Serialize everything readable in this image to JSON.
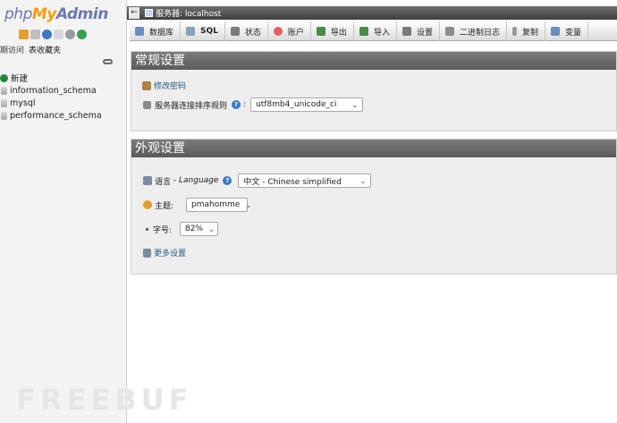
{
  "nav": {
    "logo": {
      "part1": "php",
      "part2": "My",
      "part3": "Admin"
    },
    "tabs": [
      "期访问",
      "表收藏夹"
    ],
    "tree": [
      {
        "label": "新建",
        "icon": "new-icon"
      },
      {
        "label": "information_schema",
        "icon": "database-icon"
      },
      {
        "label": "mysql",
        "icon": "database-icon"
      },
      {
        "label": "performance_schema",
        "icon": "database-icon"
      }
    ]
  },
  "serverbar": {
    "collapse": "←",
    "label": "服务器: localhost"
  },
  "menu": [
    {
      "label": "数据库",
      "icon": "database-icon",
      "color": "#6a8cc0"
    },
    {
      "label": "SQL",
      "icon": "sql-icon",
      "color": "#8aa0c0"
    },
    {
      "label": "状态",
      "icon": "status-icon",
      "color": "#7a7a7a"
    },
    {
      "label": "账户",
      "icon": "users-icon",
      "color": "#e06060"
    },
    {
      "label": "导出",
      "icon": "export-icon",
      "color": "#4a8a4a"
    },
    {
      "label": "导入",
      "icon": "import-icon",
      "color": "#4a8a4a"
    },
    {
      "label": "设置",
      "icon": "wrench-icon",
      "color": "#7a7a7a"
    },
    {
      "label": "二进制日志",
      "icon": "binlog-icon",
      "color": "#8a8a8a"
    },
    {
      "label": "复制",
      "icon": "replication-icon",
      "color": "#9a9a9a"
    },
    {
      "label": "变量",
      "icon": "variables-icon",
      "color": "#6a8cc0"
    }
  ],
  "general": {
    "title": "常规设置",
    "change_password": "修改密码",
    "collation_label": "服务器连接排序规则",
    "collation_colon": ":",
    "collation_value": "utf8mb4_unicode_ci"
  },
  "appearance": {
    "title": "外观设置",
    "language_label": "语言",
    "language_sep": " - ",
    "language_en": "Language",
    "language_value": "中文 - Chinese simplified",
    "theme_label": "主题:",
    "theme_value": "pmahomme",
    "fontsize_label": "字号:",
    "fontsize_value": "82%",
    "more_settings": "更多设置"
  },
  "colors": {
    "header_bg": "#6a6a6a",
    "panel_bg": "#eeeeee",
    "link": "#235a81"
  }
}
